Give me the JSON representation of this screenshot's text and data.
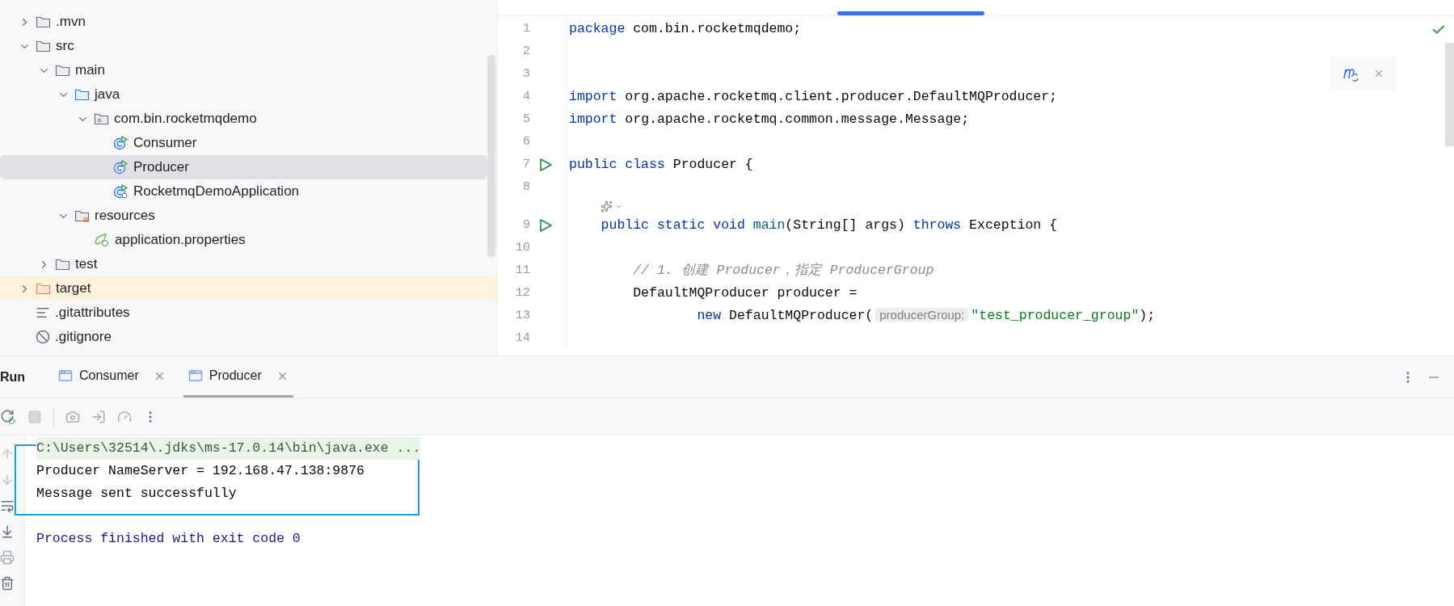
{
  "project_tree": [
    {
      "label": ".mvn",
      "kind": "folder",
      "expanded": false,
      "selected": false
    },
    {
      "label": "src",
      "kind": "folder",
      "expanded": true,
      "selected": false,
      "children": [
        {
          "label": "main",
          "kind": "folder",
          "expanded": true,
          "selected": false,
          "children": [
            {
              "label": "java",
              "kind": "source-folder",
              "expanded": true,
              "selected": false,
              "children": [
                {
                  "label": "com.bin.rocketmqdemo",
                  "kind": "package",
                  "expanded": true,
                  "selected": false,
                  "children": [
                    {
                      "label": "Consumer",
                      "kind": "class",
                      "selected": false
                    },
                    {
                      "label": "Producer",
                      "kind": "class",
                      "selected": true
                    },
                    {
                      "label": "RocketmqDemoApplication",
                      "kind": "app-class",
                      "selected": false
                    }
                  ]
                }
              ]
            },
            {
              "label": "resources",
              "kind": "resources-folder",
              "expanded": true,
              "selected": false,
              "children": [
                {
                  "label": "application.properties",
                  "kind": "properties",
                  "selected": false
                }
              ]
            }
          ]
        },
        {
          "label": "test",
          "kind": "folder",
          "expanded": false,
          "selected": false
        }
      ]
    },
    {
      "label": "target",
      "kind": "excluded-folder",
      "expanded": false,
      "selected": false
    },
    {
      "label": ".gitattributes",
      "kind": "text-file",
      "selected": false
    },
    {
      "label": ".gitignore",
      "kind": "ignore-file",
      "selected": false
    }
  ],
  "editor": {
    "lines": [
      {
        "number": "1",
        "runnable": false,
        "tokens": [
          {
            "kind": "keyword",
            "text": "package"
          },
          {
            "kind": "plain",
            "text": " com.bin.rocketmqdemo;"
          }
        ]
      },
      {
        "number": "2",
        "runnable": false
      },
      {
        "number": "3",
        "runnable": false
      },
      {
        "number": "4",
        "runnable": false,
        "tokens": [
          {
            "kind": "keyword",
            "text": "import"
          },
          {
            "kind": "plain",
            "text": " org.apache.rocketmq.client.producer.DefaultMQProducer;"
          }
        ]
      },
      {
        "number": "5",
        "runnable": false,
        "tokens": [
          {
            "kind": "keyword",
            "text": "import"
          },
          {
            "kind": "plain",
            "text": " org.apache.rocketmq.common.message.Message;"
          }
        ]
      },
      {
        "number": "6",
        "runnable": false
      },
      {
        "number": "7",
        "runnable": true,
        "tokens": [
          {
            "kind": "keyword",
            "text": "public class"
          },
          {
            "kind": "plain",
            "text": " Producer {"
          }
        ]
      },
      {
        "number": "8",
        "runnable": false,
        "inlay_after": true
      },
      {
        "number": "9",
        "runnable": true,
        "tokens": [
          {
            "kind": "keyword",
            "text": "    public static void"
          },
          {
            "kind": "method",
            "text": " main"
          },
          {
            "kind": "plain",
            "text": "(String[] args) "
          },
          {
            "kind": "keyword",
            "text": "throws"
          },
          {
            "kind": "plain",
            "text": " Exception {"
          }
        ]
      },
      {
        "number": "10",
        "runnable": false
      },
      {
        "number": "11",
        "runnable": false,
        "tokens": [
          {
            "kind": "comment",
            "text": "        // 1. 创建 Producer，指定 ProducerGroup"
          }
        ]
      },
      {
        "number": "12",
        "runnable": false,
        "tokens": [
          {
            "kind": "plain",
            "text": "        DefaultMQProducer producer ="
          }
        ]
      },
      {
        "number": "13",
        "runnable": false,
        "tokens": [
          {
            "kind": "keyword",
            "text": "                new"
          },
          {
            "kind": "plain",
            "text": " DefaultMQProducer("
          },
          {
            "kind": "hint",
            "text": "producerGroup:"
          },
          {
            "kind": "string",
            "text": "\"test_producer_group\""
          },
          {
            "kind": "plain",
            "text": ");"
          }
        ]
      },
      {
        "number": "14",
        "runnable": false
      }
    ]
  },
  "run_panel": {
    "title": "Run",
    "tabs": [
      {
        "label": "Consumer",
        "selected": false
      },
      {
        "label": "Producer",
        "selected": true
      }
    ],
    "console": [
      {
        "kind": "command",
        "text": "C:\\Users\\32514\\.jdks\\ms-17.0.14\\bin\\java.exe ..."
      },
      {
        "kind": "output",
        "text": "Producer NameServer = 192.168.47.138:9876"
      },
      {
        "kind": "output",
        "text": "Message sent successfully"
      },
      {
        "kind": "exit",
        "text": "Process finished with exit code 0"
      }
    ]
  }
}
